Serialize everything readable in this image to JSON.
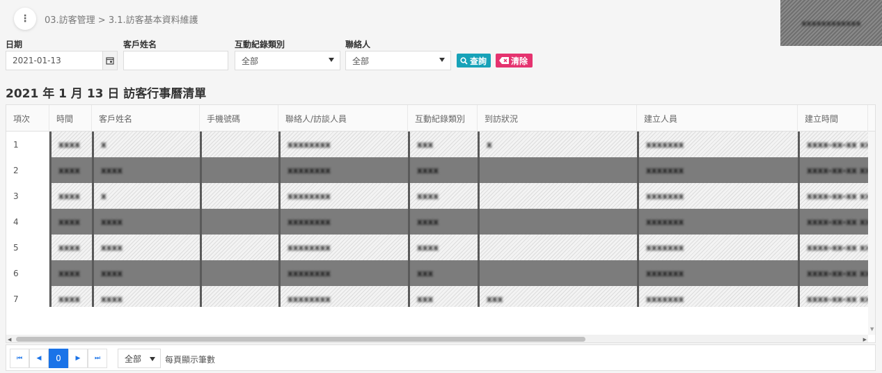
{
  "header": {
    "breadcrumb": "03.訪客管理 > 3.1.訪客基本資料維護",
    "menu_icon": "more-vertical-icon",
    "user_name": "xxxxxxxxxxxx"
  },
  "filters": {
    "date_label": "日期",
    "date_value": "2021-01-13",
    "customer_label": "客戶姓名",
    "customer_value": "",
    "type_label": "互動紀錄類別",
    "type_value": "全部",
    "contact_label": "聯絡人",
    "contact_value": "全部",
    "search_label": "查詢",
    "clear_label": "清除"
  },
  "list_title": "2021 年 1 月 13 日 訪客行事曆清單",
  "table": {
    "columns": [
      "項次",
      "時間",
      "客戶姓名",
      "手機號碼",
      "聯絡人/訪談人員",
      "互動紀錄類別",
      "到訪狀況",
      "建立人員",
      "建立時間"
    ],
    "rows": [
      {
        "idx": "1",
        "time": "xxxx",
        "name": "x",
        "phone": "",
        "contact": "xxxxxxxx",
        "type": "xxx",
        "status": "x",
        "creator": "xxxxxxx",
        "created": "xxxx-xx-xx xxx"
      },
      {
        "idx": "2",
        "time": "xxxx",
        "name": "xxxx",
        "phone": "",
        "contact": "xxxxxxxx",
        "type": "xxxx",
        "status": "",
        "creator": "xxxxxxx",
        "created": "xxxx-xx-xx xxx"
      },
      {
        "idx": "3",
        "time": "xxxx",
        "name": "x",
        "phone": "",
        "contact": "xxxxxxxx",
        "type": "xxxx",
        "status": "",
        "creator": "xxxxxxx",
        "created": "xxxx-xx-xx xxx"
      },
      {
        "idx": "4",
        "time": "xxxx",
        "name": "xxxx",
        "phone": "",
        "contact": "xxxxxxxx",
        "type": "xxxx",
        "status": "",
        "creator": "xxxxxxx",
        "created": "xxxx-xx-xx xxx"
      },
      {
        "idx": "5",
        "time": "xxxx",
        "name": "xxxx",
        "phone": "",
        "contact": "xxxxxxxx",
        "type": "xxxx",
        "status": "",
        "creator": "xxxxxxx",
        "created": "xxxx-xx-xx xxx"
      },
      {
        "idx": "6",
        "time": "xxxx",
        "name": "xxxx",
        "phone": "",
        "contact": "xxxxxxxx",
        "type": "xxx",
        "status": "",
        "creator": "xxxxxxx",
        "created": "xxxx-xx-xx xxx"
      },
      {
        "idx": "7",
        "time": "xxxx",
        "name": "xxxx",
        "phone": "",
        "contact": "xxxxxxxx",
        "type": "xxx",
        "status": "xxx",
        "creator": "xxxxxxx",
        "created": "xxxx-xx-xx xxx"
      }
    ]
  },
  "pager": {
    "first_icon": "first-page-icon",
    "prev_icon": "prev-page-icon",
    "current_page": "0",
    "next_icon": "next-page-icon",
    "last_icon": "last-page-icon",
    "page_size_value": "全部",
    "page_size_label": "每頁顯示筆數"
  },
  "colors": {
    "search_button": "#17a2b8",
    "clear_button": "#e5336f",
    "active_page": "#1a73e8",
    "redacted_row": "#7c7c7c"
  }
}
